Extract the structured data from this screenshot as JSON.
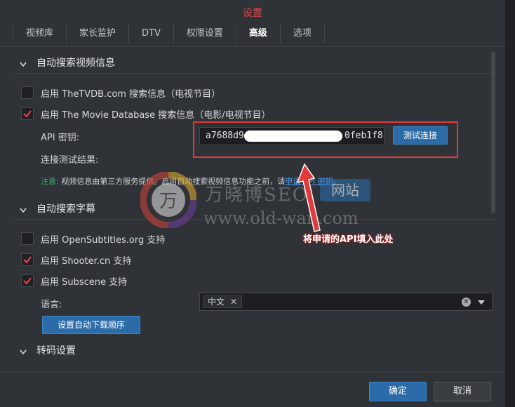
{
  "window": {
    "title": "设置"
  },
  "tabs": [
    {
      "label": "视频库"
    },
    {
      "label": "家长监护"
    },
    {
      "label": "DTV"
    },
    {
      "label": "权限设置"
    },
    {
      "label": "高级",
      "active": true
    },
    {
      "label": "选项"
    }
  ],
  "sections": {
    "auto_video_info": {
      "title": "自动搜索视频信息",
      "tvdb_label": "启用 TheTVDB.com 搜索信息（电视节目）",
      "tvdb_checked": false,
      "tmdb_label": "启用 The Movie Database 搜索信息（电影/电视节目）",
      "tmdb_checked": true,
      "api_key_label": "API 密钥:",
      "api_key_value_prefix": "a7688d9",
      "api_key_value_suffix": "0feb1f8",
      "test_button": "测试连接",
      "test_result_label": "连接测试结果:",
      "note_prefix": "注意:",
      "note_text": "视频信息由第三方服务提供。启用自动搜索视频信息功能之前，请",
      "note_link": "申请 API 密钥",
      "note_end": "。"
    },
    "auto_subtitle": {
      "title": "自动搜索字幕",
      "opensub_label": "启用 OpenSubtitles.org 支持",
      "opensub_checked": false,
      "shooter_label": "启用 Shooter.cn 支持",
      "shooter_checked": true,
      "subscene_label": "启用 Subscene 支持",
      "subscene_checked": true,
      "language_label": "语言:",
      "language_chip": "中文",
      "download_order_button": "设置自动下载顺序"
    },
    "transcode": {
      "title": "转码设置"
    }
  },
  "annotation": {
    "text": "将申请的API填入此处"
  },
  "watermark": {
    "line1": "万晓博SEO",
    "badge": "网站",
    "line2": "www.old-wan.com"
  },
  "footer": {
    "ok": "确定",
    "cancel": "取消"
  },
  "colors": {
    "accent": "#2b6ca8",
    "title": "#e0464b",
    "annotation": "#e23a3a",
    "note_green": "#38b36a"
  }
}
